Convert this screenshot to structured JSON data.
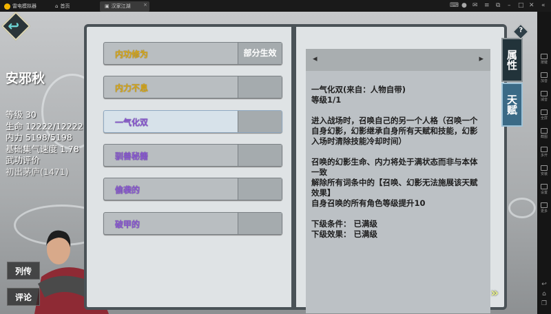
{
  "titlebar": {
    "app_name": "雷电模拟器",
    "home_tab": "首页",
    "game_tab": "汉家江湖",
    "close": "×"
  },
  "sidebar": [
    "按键",
    "加音",
    "减音",
    "全屏",
    "截图",
    "多开",
    "安装",
    "设置",
    "更多"
  ],
  "character": {
    "name": "安邪秋",
    "stats": [
      "等级 30",
      "生命 12222/12222",
      "内力 5198/5198",
      "基础集气速度 1.78",
      "武功评价"
    ],
    "evaluation": "初出茅庐(1471)"
  },
  "buttons": {
    "biography": "列传",
    "comment": "评论"
  },
  "talents": [
    {
      "label": "内功修为",
      "status": "部分生效",
      "color": "gold"
    },
    {
      "label": "内力不息",
      "status": "",
      "color": "gold"
    },
    {
      "label": "一气化双",
      "status": "",
      "color": "purple",
      "selected": true
    },
    {
      "label": "驯兽秘籍",
      "status": "",
      "color": "purple"
    },
    {
      "label": "偷袭的",
      "status": "",
      "color": "purple"
    },
    {
      "label": "破甲的",
      "status": "",
      "color": "purple"
    }
  ],
  "detail": {
    "title": "一气化双(来自：人物自带)",
    "level": "等级1/1",
    "para1": "进入战场时，召唤自己的另一个人格（召唤一个自身幻影，幻影继承自身所有天赋和技能，幻影入场时清除技能冷却时间）",
    "para2a": "召唤的幻影生命、内力将处于满状态而非与本体一致",
    "para2b": "解除所有词条中的【召唤、幻影无法施展该天赋效果】",
    "para2c": "自身召唤的所有角色等级提升10",
    "next_cond": "下级条件： 已满级",
    "next_effect": "下级效果： 已满级",
    "prev": "◂",
    "next": "▸",
    "page_next": "»"
  },
  "tabs": {
    "attributes": "属性",
    "talents": "天赋"
  },
  "help": "?"
}
